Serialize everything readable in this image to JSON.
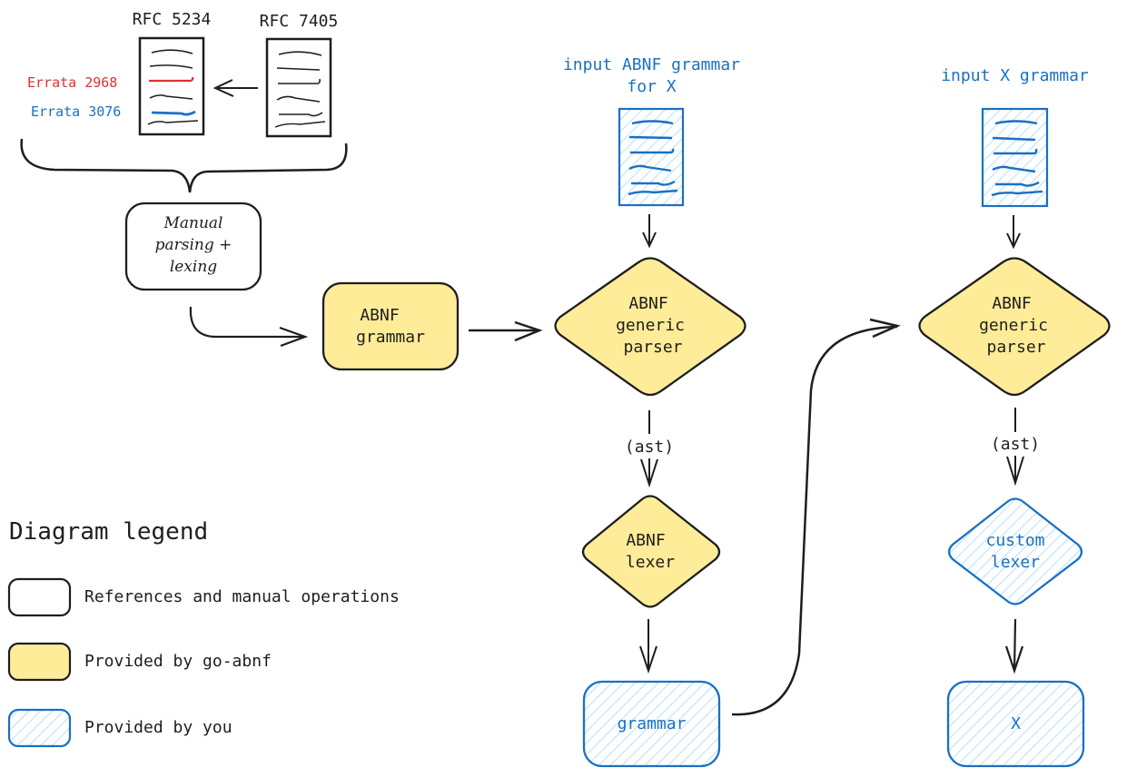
{
  "colors": {
    "stroke_dark": "#1e1e1e",
    "fill_yellow": "#ffec99",
    "stroke_blue": "#1971c2",
    "hatch_blue": "#a5d8ff",
    "errata_red": "#e03131",
    "errata_blue": "#1971c2"
  },
  "references": {
    "rfc_5234_label": "RFC 5234",
    "rfc_7405_label": "RFC 7405",
    "errata_2968": "Errata 2968",
    "errata_3076": "Errata 3076"
  },
  "nodes": {
    "manual_parsing": [
      "Manual",
      "parsing +",
      "lexing"
    ],
    "abnf_grammar": [
      "ABNF",
      "grammar"
    ],
    "input_abnf_title": [
      "input ABNF grammar",
      "for X"
    ],
    "abnf_generic_parser_1": [
      "ABNF",
      "generic",
      "parser"
    ],
    "ast_label_1": "(ast)",
    "abnf_lexer": [
      "ABNF",
      "lexer"
    ],
    "grammar_output": "grammar",
    "input_x_title": "input X grammar",
    "abnf_generic_parser_2": [
      "ABNF",
      "generic",
      "parser"
    ],
    "ast_label_2": "(ast)",
    "custom_lexer": [
      "custom",
      "lexer"
    ],
    "x_output": "X"
  },
  "legend": {
    "title": "Diagram legend",
    "items": [
      {
        "style": "plain",
        "label": "References and manual operations"
      },
      {
        "style": "yellow",
        "label": "Provided by go-abnf"
      },
      {
        "style": "hatched-blue",
        "label": "Provided by you"
      }
    ]
  }
}
